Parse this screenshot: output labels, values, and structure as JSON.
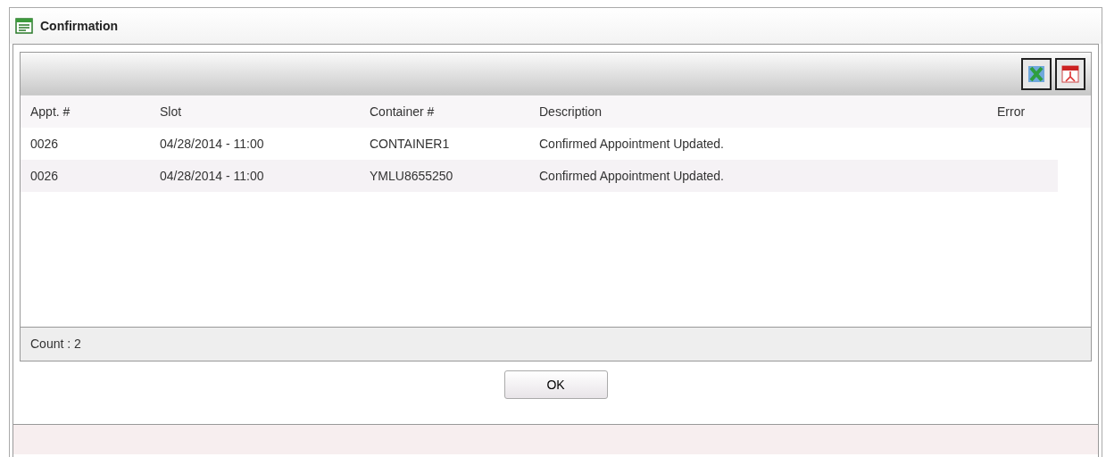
{
  "window": {
    "title": "Confirmation"
  },
  "toolbar": {
    "buttons": [
      {
        "kind": "excel"
      },
      {
        "kind": "pdf"
      }
    ]
  },
  "table": {
    "columns": [
      "Appt. #",
      "Slot",
      "Container #",
      "Description",
      "Error"
    ],
    "rows": [
      [
        "0026",
        "04/28/2014 - 11:00",
        "CONTAINER1",
        "Confirmed Appointment Updated.",
        ""
      ],
      [
        "0026",
        "04/28/2014 - 11:00",
        "YMLU8655250",
        "Confirmed Appointment Updated.",
        ""
      ]
    ]
  },
  "count": "Count : 2",
  "buttons": [
    "OK"
  ]
}
